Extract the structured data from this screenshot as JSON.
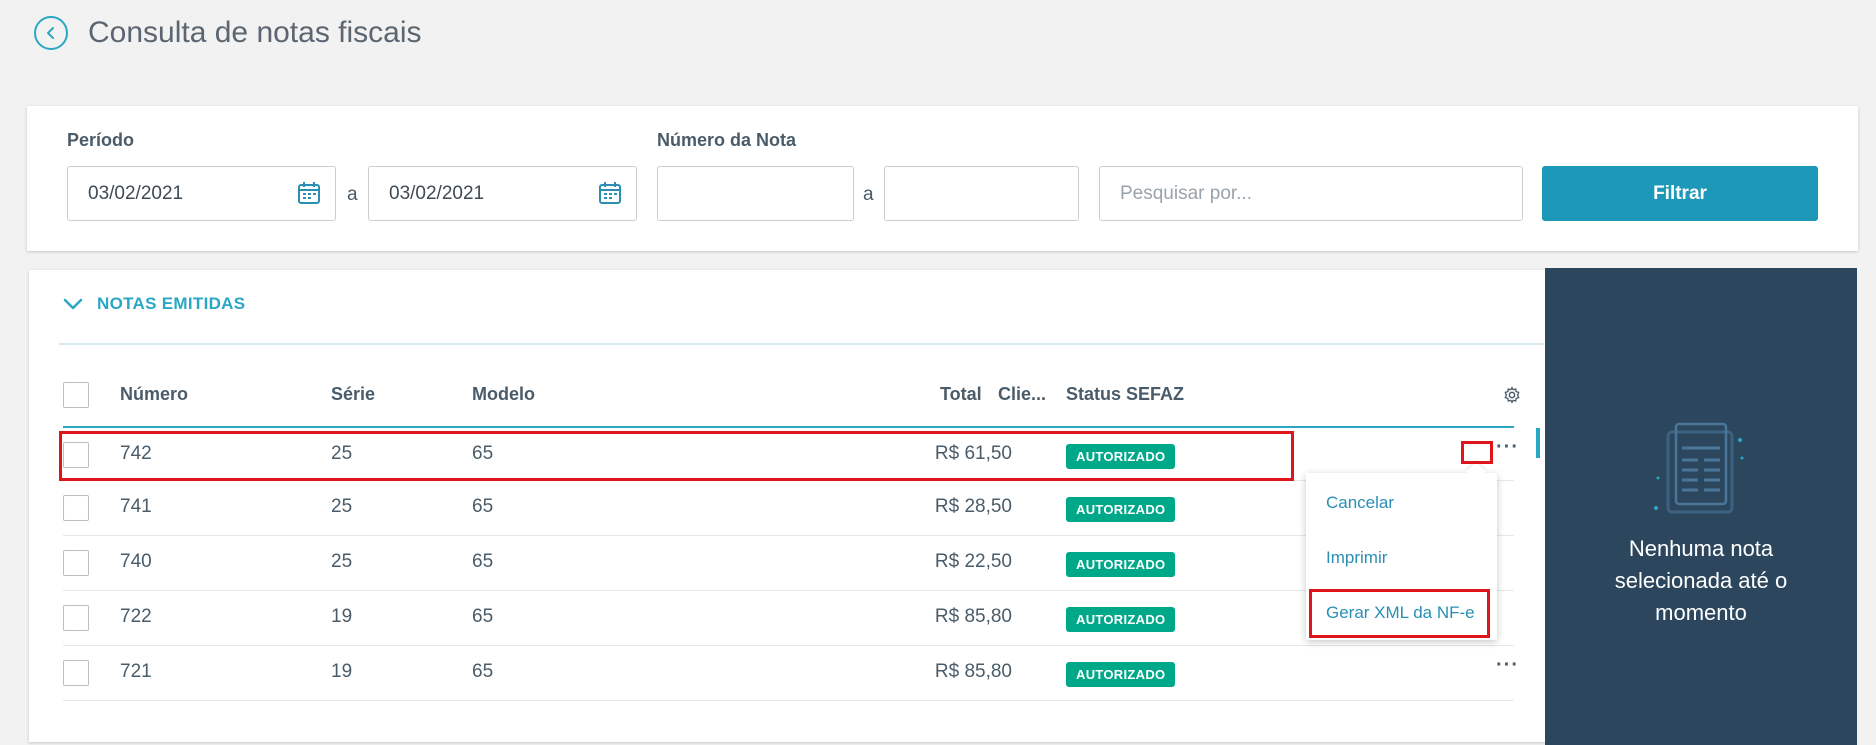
{
  "header": {
    "title": "Consulta de notas fiscais",
    "back_icon": "chevron-left-circle-icon"
  },
  "filters": {
    "periodo_label": "Período",
    "periodo_from": "03/02/2021",
    "periodo_separator": "a",
    "periodo_to": "03/02/2021",
    "numero_label": "Número da Nota",
    "numero_from": "",
    "numero_separator": "a",
    "numero_to": "",
    "search_placeholder": "Pesquisar por...",
    "filter_button": "Filtrar"
  },
  "section": {
    "title": "NOTAS EMITIDAS"
  },
  "table": {
    "columns": {
      "numero": "Número",
      "serie": "Série",
      "modelo": "Modelo",
      "total": "Total",
      "cliente": "Clie...",
      "status": "Status SEFAZ"
    },
    "rows": [
      {
        "numero": "742",
        "serie": "25",
        "modelo": "65",
        "total": "R$ 61,50",
        "status": "AUTORIZADO"
      },
      {
        "numero": "741",
        "serie": "25",
        "modelo": "65",
        "total": "R$ 28,50",
        "status": "AUTORIZADO"
      },
      {
        "numero": "740",
        "serie": "25",
        "modelo": "65",
        "total": "R$ 22,50",
        "status": "AUTORIZADO"
      },
      {
        "numero": "722",
        "serie": "19",
        "modelo": "65",
        "total": "R$ 85,80",
        "status": "AUTORIZADO"
      },
      {
        "numero": "721",
        "serie": "19",
        "modelo": "65",
        "total": "R$ 85,80",
        "status": "AUTORIZADO"
      }
    ],
    "more_label": "···"
  },
  "menu": {
    "items": [
      "Cancelar",
      "Imprimir",
      "Gerar XML da NF-e"
    ]
  },
  "side_panel": {
    "message": "Nenhuma nota selecionada até o momento"
  },
  "colors": {
    "accent": "#1d98b8",
    "status_ok": "#00a88a",
    "panel_bg": "#2c465e",
    "highlight": "#e0141b"
  }
}
